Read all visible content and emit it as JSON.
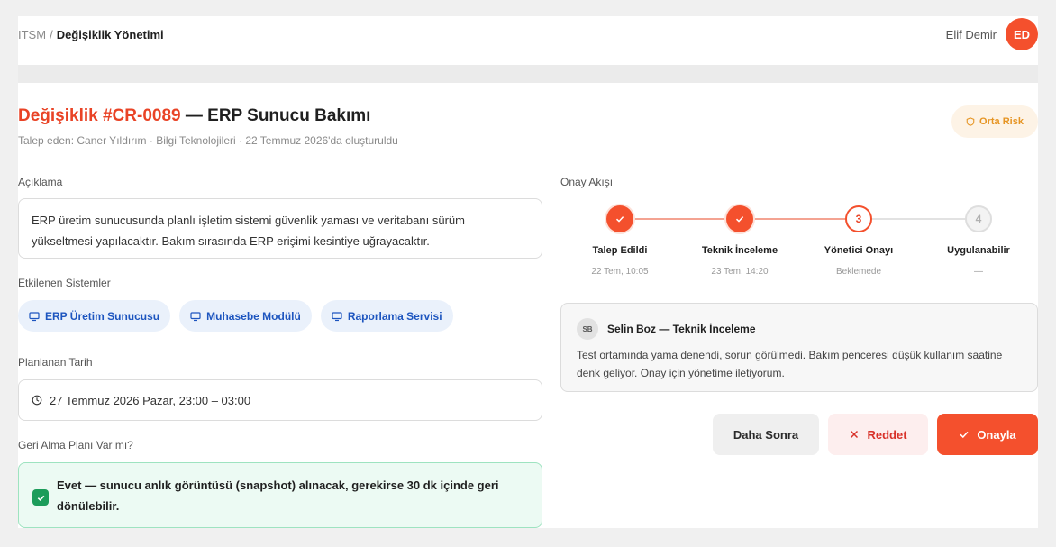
{
  "header": {
    "breadcrumb": {
      "root": "ITSM",
      "separator": "/",
      "current": "Değişiklik Yönetimi"
    },
    "user": {
      "name": "Elif Demir",
      "initials": "ED"
    }
  },
  "change": {
    "title_prefix": "Değişiklik #CR-0089",
    "title_rest": "— ERP Sunucu Bakımı",
    "subtitle": "Talep eden: Caner Yıldırım · Bilgi Teknolojileri · 22 Temmuz 2026'da oluşturuldu",
    "risk": {
      "label": "Orta Risk",
      "icon": "shield-icon",
      "color": "#e69524"
    }
  },
  "description": {
    "label": "Açıklama",
    "text": "ERP üretim sunucusunda planlı işletim sistemi güvenlik yaması ve veritabanı sürüm yükseltmesi yapılacaktır. Bakım sırasında ERP erişimi kesintiye uğrayacaktır."
  },
  "systems": {
    "label": "Etkilenen Sistemler",
    "items": [
      {
        "label": "ERP Üretim Sunucusu",
        "icon": "monitor-icon"
      },
      {
        "label": "Muhasebe Modülü",
        "icon": "monitor-icon"
      },
      {
        "label": "Raporlama Servisi",
        "icon": "monitor-icon"
      }
    ]
  },
  "schedule": {
    "label": "Planlanan Tarih",
    "value": "27 Temmuz 2026 Pazar, 23:00 – 03:00",
    "icon": "clock-icon"
  },
  "rollback": {
    "label": "Geri Alma Planı Var mı?",
    "text": "Evet — sunucu anlık görüntüsü (snapshot) alınacak, gerekirse 30 dk içinde geri dönülebilir.",
    "checked": true
  },
  "approval_flow": {
    "label": "Onay Akışı",
    "steps": [
      {
        "number": "1",
        "name": "Talep Edildi",
        "time": "22 Tem, 10:05",
        "status": "done"
      },
      {
        "number": "2",
        "name": "Teknik İnceleme",
        "time": "23 Tem, 14:20",
        "status": "done"
      },
      {
        "number": "3",
        "name": "Yönetici Onayı",
        "time": "Beklemede",
        "status": "active"
      },
      {
        "number": "4",
        "name": "Uygulanabilir",
        "time": "—",
        "status": "pending"
      }
    ]
  },
  "comment": {
    "initials": "SB",
    "author": "Selin Boz — Teknik İnceleme",
    "text": "Test ortamında yama denendi, sorun görülmedi. Bakım penceresi düşük kullanım saatine denk geliyor. Onay için yönetime iletiyorum."
  },
  "actions": {
    "later": "Daha Sonra",
    "reject": "Reddet",
    "approve": "Onayla"
  },
  "colors": {
    "accent": "#f4502d",
    "link_blue": "#1d55bf",
    "success": "#1c9c5a",
    "danger": "#d8322a"
  }
}
